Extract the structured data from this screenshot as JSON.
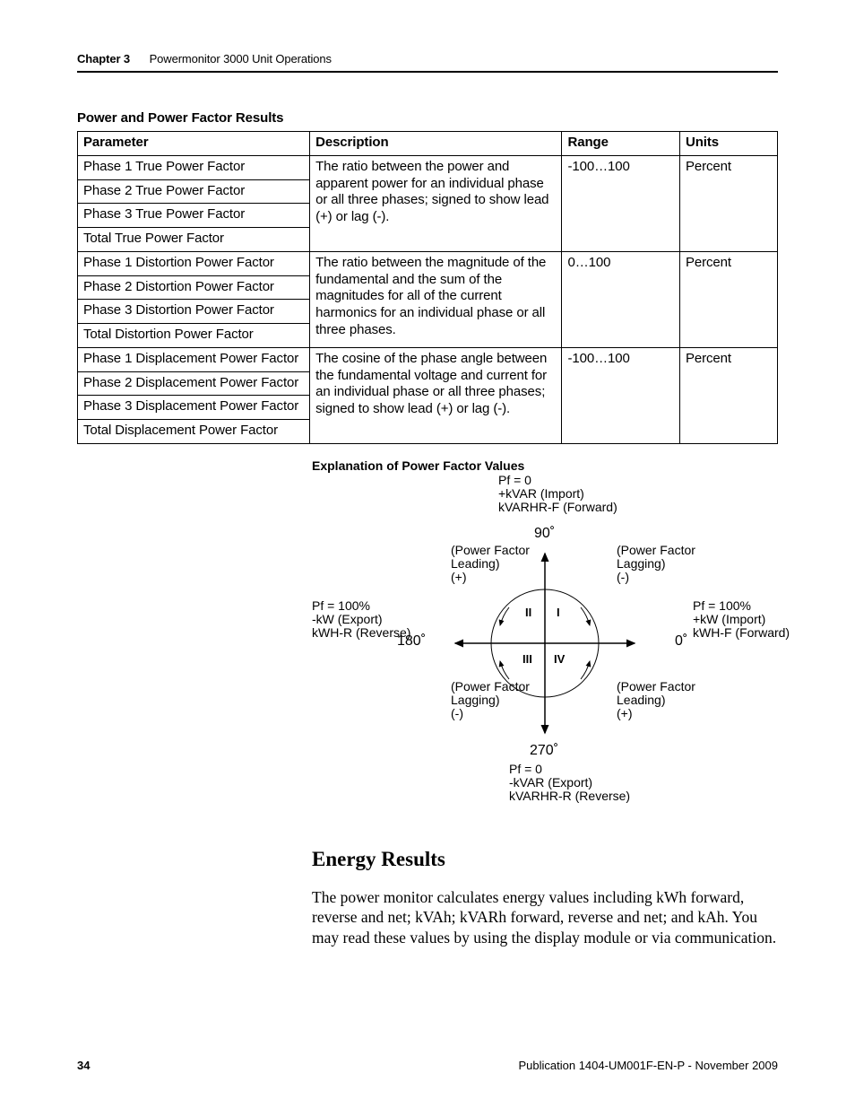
{
  "header": {
    "chapter": "Chapter 3",
    "title": "Powermonitor 3000 Unit Operations"
  },
  "table": {
    "title": "Power and Power Factor Results",
    "columns": [
      "Parameter",
      "Description",
      "Range",
      "Units"
    ],
    "groups": [
      {
        "params": [
          "Phase 1 True Power Factor",
          "Phase 2 True Power Factor",
          "Phase 3 True Power Factor",
          "Total True Power Factor"
        ],
        "description": "The ratio between the power and apparent power for an individual phase or all three phases; signed to show lead (+) or lag (-).",
        "range": "-100…100",
        "units": "Percent"
      },
      {
        "params": [
          "Phase 1 Distortion Power Factor",
          "Phase 2 Distortion Power Factor",
          "Phase 3 Distortion Power Factor",
          "Total Distortion Power Factor"
        ],
        "description": "The ratio between the magnitude of the fundamental and the sum of the magnitudes for all of the current harmonics for an individual phase or all three phases.",
        "range": "0…100",
        "units": "Percent"
      },
      {
        "params": [
          "Phase 1 Displacement Power Factor",
          "Phase 2 Displacement Power Factor",
          "Phase 3 Displacement Power Factor",
          "Total Displacement Power Factor"
        ],
        "description": "The cosine of the phase angle between the fundamental voltage and current for an individual phase or all three phases; signed to show lead (+) or lag (-).",
        "range": "-100…100",
        "units": "Percent"
      }
    ]
  },
  "diagram": {
    "title": "Explanation of Power Factor Values",
    "top": {
      "pf": "Pf = 0",
      "kvar": "+kVAR (Import)",
      "kvarhr": "kVARHR-F (Forward)",
      "angle": "90˚"
    },
    "right": {
      "angle": "0˚",
      "pf": "Pf = 100%",
      "kw": "+kW (Import)",
      "kwh": "kWH-F (Forward)"
    },
    "bottom": {
      "angle": "270˚",
      "pf": "Pf = 0",
      "kvar": "-kVAR (Export)",
      "kvarhr": "kVARHR-R (Reverse)"
    },
    "left": {
      "angle": "180˚",
      "pf": "Pf = 100%",
      "kw": "-kW (Export)",
      "kwh": "kWH-R (Reverse)"
    },
    "q1": {
      "line1": "(Power Factor",
      "line2": "Lagging)",
      "line3": "(-)",
      "label": "I"
    },
    "q2": {
      "line1": "(Power Factor",
      "line2": "Leading)",
      "line3": "(+)",
      "label": "II"
    },
    "q3": {
      "line1": "(Power Factor",
      "line2": "Lagging)",
      "line3": "(-)",
      "label": "III"
    },
    "q4": {
      "line1": "(Power Factor",
      "line2": "Leading)",
      "line3": "(+)",
      "label": "IV"
    }
  },
  "section": {
    "title": "Energy Results",
    "body": "The power monitor calculates energy values including kWh forward, reverse and net; kVAh; kVARh forward, reverse and net; and kAh. You may read these values by using the display module or via communication."
  },
  "footer": {
    "page": "34",
    "publication": "Publication 1404-UM001F-EN-P - November 2009"
  }
}
